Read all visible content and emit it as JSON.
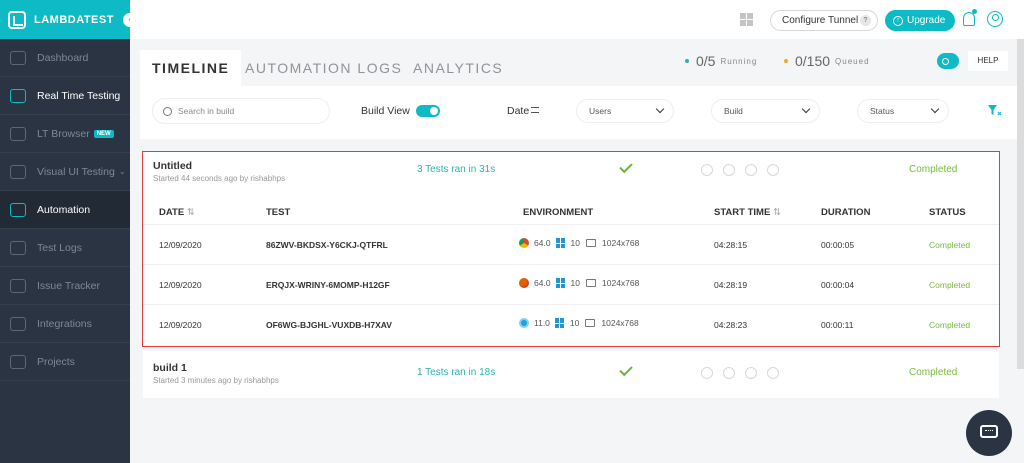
{
  "brand": {
    "name": "LAMBDATEST",
    "accent": "#0ebac5"
  },
  "sidebar": {
    "items": [
      {
        "label": "Dashboard",
        "icon": "speedometer-icon"
      },
      {
        "label": "Real Time Testing",
        "icon": "clock-icon"
      },
      {
        "label": "LT Browser",
        "icon": "browser-icon",
        "badge": "NEW"
      },
      {
        "label": "Visual UI Testing",
        "icon": "eye-icon"
      },
      {
        "label": "Automation",
        "icon": "robot-icon"
      },
      {
        "label": "Test Logs",
        "icon": "cube-icon"
      },
      {
        "label": "Issue Tracker",
        "icon": "bug-icon"
      },
      {
        "label": "Integrations",
        "icon": "puzzle-icon"
      },
      {
        "label": "Projects",
        "icon": "folder-icon"
      }
    ]
  },
  "topbar": {
    "configure_tunnel": "Configure Tunnel",
    "tunnel_help": "?",
    "upgrade": "Upgrade"
  },
  "tabs": [
    "TIMELINE",
    "AUTOMATION LOGS",
    "ANALYTICS"
  ],
  "stats": {
    "running_value": "0/5",
    "running_label": "Running",
    "queued_value": "0/150",
    "queued_label": "Queued"
  },
  "help_label": "HELP",
  "filters": {
    "search_placeholder": "Search in build",
    "build_view": "Build View",
    "date": "Date",
    "users": "Users",
    "build": "Build",
    "status": "Status"
  },
  "builds": [
    {
      "name": "Untitled",
      "subtitle": "Started 44 seconds ago by rishabhps",
      "tests_ran": "3 Tests ran in 31s",
      "status": "Completed",
      "columns": [
        "DATE",
        "TEST",
        "ENVIRONMENT",
        "START TIME",
        "DURATION",
        "STATUS"
      ],
      "rows": [
        {
          "date": "12/09/2020",
          "test": "86ZWV-BKDSX-Y6CKJ-QTFRL",
          "browser_icon": "chrome-icon",
          "browser_version": "64.0",
          "os_version": "10",
          "resolution": "1024x768",
          "start_time": "04:28:15",
          "duration": "00:00:05",
          "status": "Completed"
        },
        {
          "date": "12/09/2020",
          "test": "ERQJX-WRINY-6MOMP-H12GF",
          "browser_icon": "firefox-icon",
          "browser_version": "64.0",
          "os_version": "10",
          "resolution": "1024x768",
          "start_time": "04:28:19",
          "duration": "00:00:04",
          "status": "Completed"
        },
        {
          "date": "12/09/2020",
          "test": "OF6WG-BJGHL-VUXDB-H7XAV",
          "browser_icon": "ie-icon",
          "browser_version": "11.0",
          "os_version": "10",
          "resolution": "1024x768",
          "start_time": "04:28:23",
          "duration": "00:00:11",
          "status": "Completed"
        }
      ]
    },
    {
      "name": "build 1",
      "subtitle": "Started 3 minutes ago by rishabhps",
      "tests_ran": "1 Tests ran in 18s",
      "status": "Completed"
    }
  ]
}
